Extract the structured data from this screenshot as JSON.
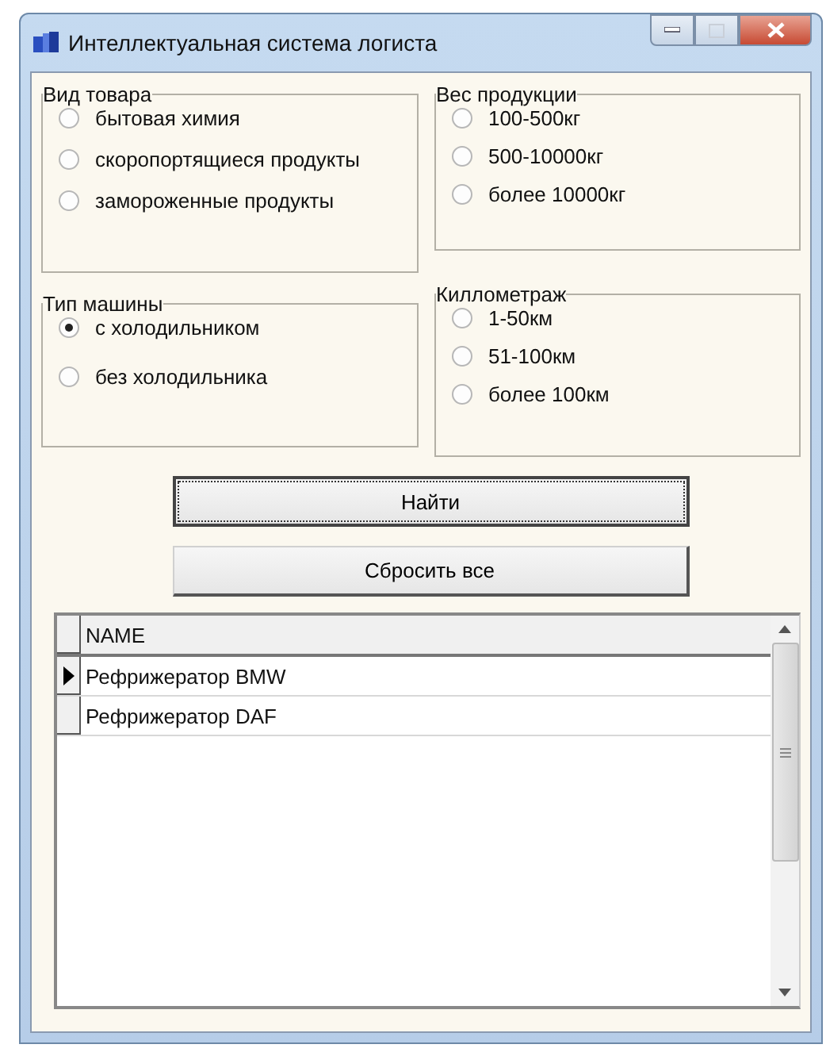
{
  "window": {
    "title": "Интеллектуальная система логиста"
  },
  "groups": [
    {
      "title": "Вид товара",
      "options": [
        {
          "label": "бытовая химия",
          "selected": false
        },
        {
          "label": "скоропортящиеся продукты",
          "selected": false
        },
        {
          "label": "замороженные продукты",
          "selected": false
        }
      ]
    },
    {
      "title": "Вес продукции",
      "options": [
        {
          "label": "100-500кг",
          "selected": false
        },
        {
          "label": "500-10000кг",
          "selected": false
        },
        {
          "label": "более 10000кг",
          "selected": false
        }
      ]
    },
    {
      "title": "Тип машины",
      "options": [
        {
          "label": "с холодильником",
          "selected": true
        },
        {
          "label": "без холодильника",
          "selected": false
        }
      ]
    },
    {
      "title": "Киллометраж",
      "options": [
        {
          "label": "1-50км",
          "selected": false
        },
        {
          "label": "51-100км",
          "selected": false
        },
        {
          "label": "более 100км",
          "selected": false
        }
      ]
    }
  ],
  "buttons": [
    {
      "label": "Найти",
      "focused": true
    },
    {
      "label": "Сбросить все",
      "focused": false
    }
  ],
  "grid": {
    "columns": [
      "NAME"
    ],
    "rows": [
      {
        "cells": [
          "Рефрижератор BMW"
        ],
        "selected": true
      },
      {
        "cells": [
          "Рефрижератор DAF"
        ],
        "selected": false
      }
    ]
  }
}
